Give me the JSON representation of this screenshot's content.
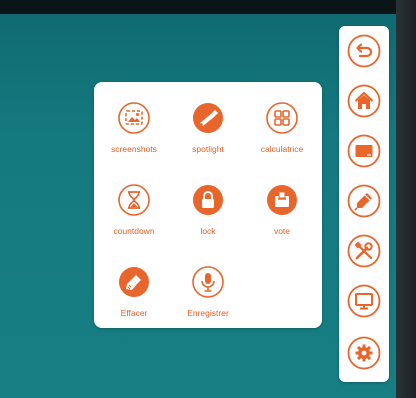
{
  "colors": {
    "accent": "#e8662c",
    "background": "#177f84",
    "panel": "#ffffff"
  },
  "tools": [
    {
      "label": "screenshots",
      "icon": "screenshot-icon"
    },
    {
      "label": "spotlight",
      "icon": "spotlight-icon"
    },
    {
      "label": "calculatrice",
      "icon": "calculator-icon"
    },
    {
      "label": "countdown",
      "icon": "hourglass-icon"
    },
    {
      "label": "lock",
      "icon": "lock-icon"
    },
    {
      "label": "vote",
      "icon": "ballot-box-icon"
    },
    {
      "label": "Effacer",
      "icon": "brush-icon"
    },
    {
      "label": "Enregistrer",
      "icon": "microphone-icon"
    }
  ],
  "sidebar": {
    "buttons": [
      {
        "icon": "back-icon"
      },
      {
        "icon": "home-icon"
      },
      {
        "icon": "whiteboard-icon"
      },
      {
        "icon": "pen-icon"
      },
      {
        "icon": "tools-icon"
      },
      {
        "icon": "monitor-icon"
      },
      {
        "icon": "settings-icon"
      }
    ]
  }
}
